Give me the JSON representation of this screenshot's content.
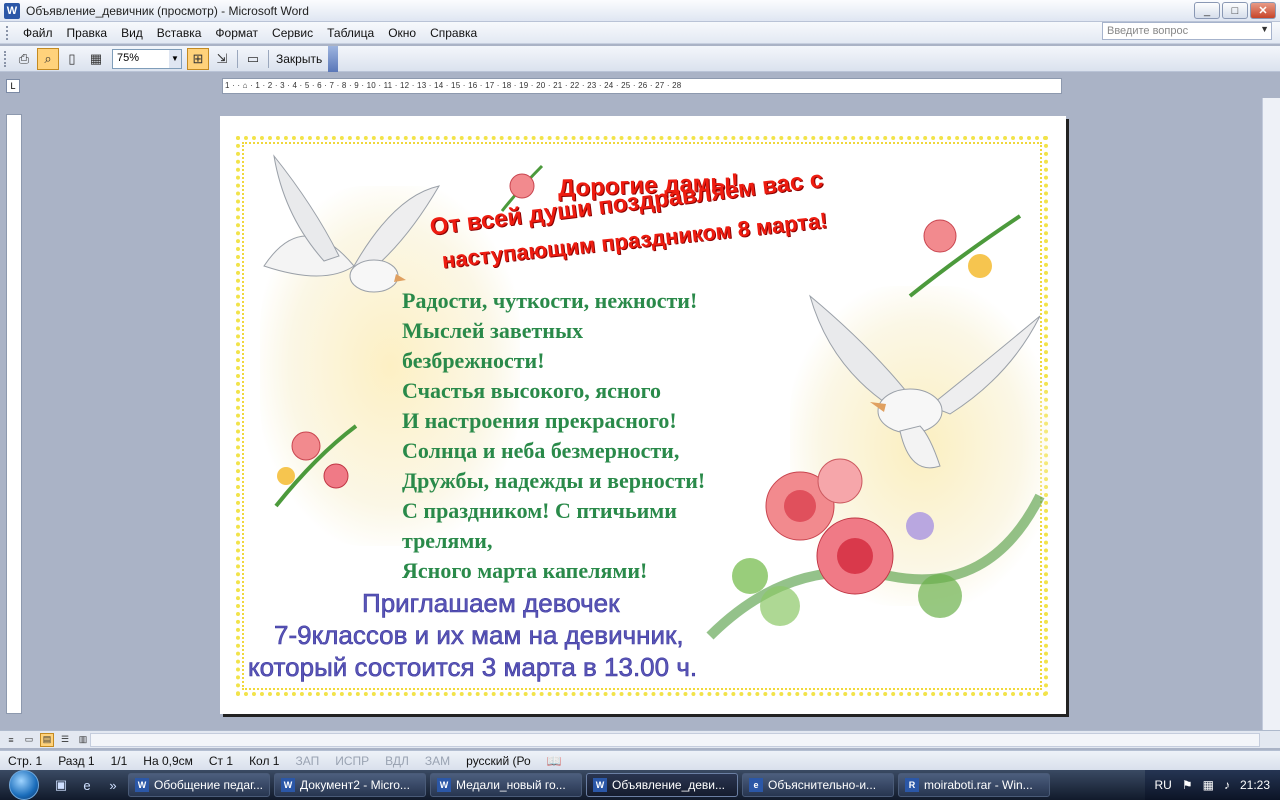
{
  "window": {
    "title": "Объявление_девичник (просмотр) - Microsoft Word",
    "app_icon": "W"
  },
  "menu": {
    "items": [
      "Файл",
      "Правка",
      "Вид",
      "Вставка",
      "Формат",
      "Сервис",
      "Таблица",
      "Окно",
      "Справка"
    ],
    "help_placeholder": "Введите вопрос"
  },
  "toolbar": {
    "zoom": "75%",
    "close_label": "Закрыть"
  },
  "ruler": {
    "marks": "1 · · ⌂ · 1 · 2 · 3 · 4 · 5 · 6 · 7 · 8 · 9 · 10 · 11 · 12 · 13 · 14 · 15 · 16 · 17 · 18 · 19 · 20 · 21 · 22 · 23 · 24 · 25 · 26 · 27 · 28"
  },
  "document": {
    "headline": [
      "Дорогие дамы!",
      "От всей души поздравляем вас с",
      "наступающим праздником 8 марта!"
    ],
    "poem": [
      "Радости, чуткости, нежности!",
      "Мыслей заветных",
      "безбрежности!",
      "Счастья высокого, ясного",
      "И настроения прекрасного!",
      "Солнца и неба безмерности,",
      "Дружбы, надежды и верности!",
      "С праздником! С птичьими",
      "трелями,",
      "Ясного марта капелями!"
    ],
    "invite": [
      "Приглашаем девочек",
      "7-9классов и их мам на девичник,",
      "который состоится 3 марта в 13.00 ч."
    ],
    "colors": {
      "headline": "#ee1c10",
      "poem": "#2a8a4a",
      "invite": "#5a56b7",
      "border": "#f2e34a"
    }
  },
  "status": {
    "page": "Стр. 1",
    "section": "Разд 1",
    "pages": "1/1",
    "position": "На 0,9см",
    "line": "Ст 1",
    "column": "Кол 1",
    "rec": "ЗАП",
    "trk": "ИСПР",
    "ext": "ВДЛ",
    "ovr": "ЗАМ",
    "language": "русский (Ро"
  },
  "taskbar": {
    "tasks": [
      {
        "label": "Обобщение педаг...",
        "icon": "W",
        "active": false
      },
      {
        "label": "Документ2 - Micro...",
        "icon": "W",
        "active": false
      },
      {
        "label": "Медали_новый го...",
        "icon": "W",
        "active": false
      },
      {
        "label": "Объявление_деви...",
        "icon": "W",
        "active": true
      },
      {
        "label": "Объяснительно-и...",
        "icon": "e",
        "active": false
      },
      {
        "label": "moiraboti.rar - Win...",
        "icon": "R",
        "active": false
      }
    ],
    "lang": "RU",
    "clock": "21:23"
  }
}
